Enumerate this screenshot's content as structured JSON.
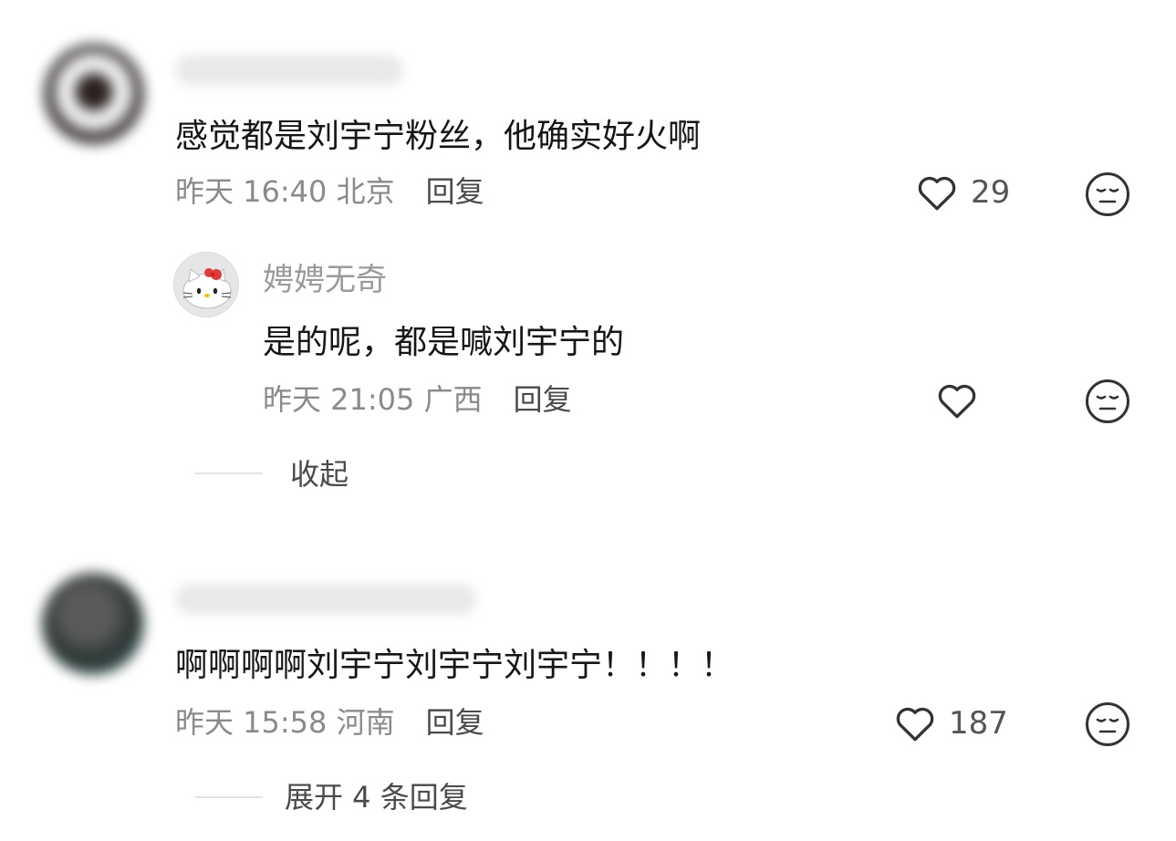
{
  "comments": [
    {
      "content": "感觉都是刘宇宁粉丝，他确实好火啊",
      "meta": "昨天 16:40 北京",
      "reply_label": "回复",
      "likes": "29",
      "replies": [
        {
          "nickname": "娉娉无奇",
          "content": "是的呢，都是喊刘宇宁的",
          "meta": "昨天 21:05 广西",
          "reply_label": "回复"
        }
      ],
      "thread_toggle": "收起"
    },
    {
      "content": "啊啊啊啊刘宇宁刘宇宁刘宇宁！！！！",
      "meta": "昨天 15:58 河南",
      "reply_label": "回复",
      "likes": "187",
      "thread_toggle": "展开 4 条回复"
    }
  ],
  "icons": {
    "like": "heart-outline-icon",
    "dislike": "unamused-face-icon"
  },
  "colors": {
    "text": "#161616",
    "meta": "#8a8a8a",
    "secondary": "#4a4a4a"
  }
}
